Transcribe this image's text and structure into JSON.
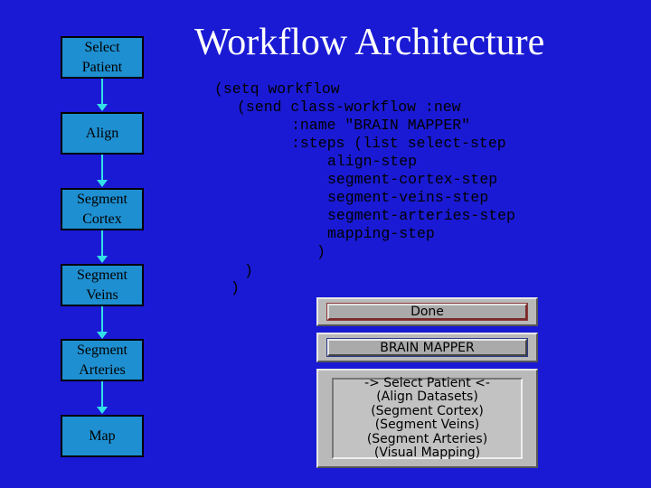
{
  "title": "Workflow Architecture",
  "flow": {
    "steps": [
      [
        "Select",
        "Patient"
      ],
      [
        "Align"
      ],
      [
        "Segment",
        "Cortex"
      ],
      [
        "Segment",
        "Veins"
      ],
      [
        "Segment",
        "Arteries"
      ],
      [
        "Map"
      ]
    ]
  },
  "code": {
    "lines": [
      "(setq workflow",
      "(send class-workflow :new",
      ":name \"BRAIN MAPPER\"",
      ":steps (list select-step",
      "align-step",
      "segment-cortex-step",
      "segment-veins-step",
      "segment-arteries-step",
      "mapping-step",
      ")",
      ")",
      ")"
    ]
  },
  "ui": {
    "done_label": "Done",
    "workflow_name": "BRAIN MAPPER",
    "step_list": [
      "-> Select Patient <-",
      "(Align Datasets)",
      "(Segment Cortex)",
      "(Segment Veins)",
      "(Segment Arteries)",
      "(Visual Mapping)"
    ]
  }
}
